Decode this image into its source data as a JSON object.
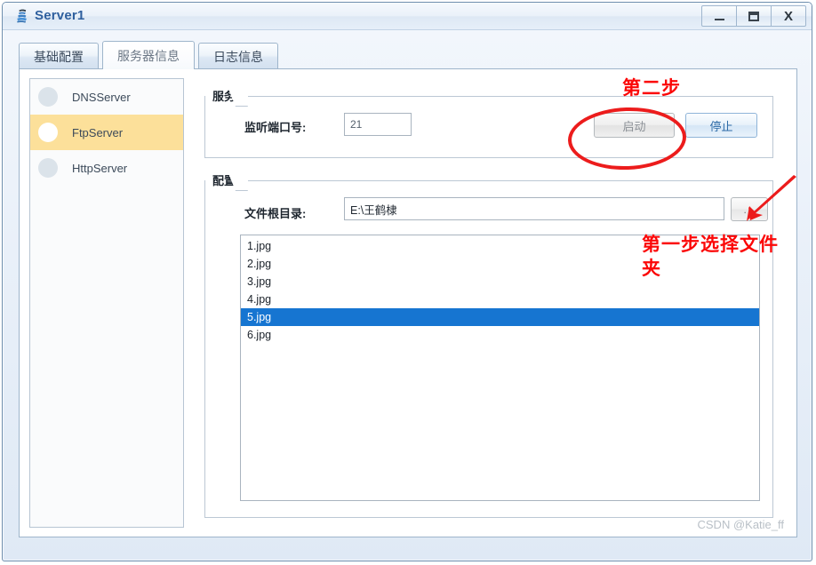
{
  "window": {
    "title": "Server1",
    "icon": "java-duke-icon",
    "controls": {
      "minimize": "_",
      "maximize": "□",
      "close": "X"
    }
  },
  "tabs": [
    {
      "label": "基础配置",
      "selected": false
    },
    {
      "label": "服务器信息",
      "selected": true
    },
    {
      "label": "日志信息",
      "selected": false
    }
  ],
  "sidebar": {
    "items": [
      {
        "label": "DNSServer",
        "selected": false
      },
      {
        "label": "FtpServer",
        "selected": true
      },
      {
        "label": "HttpServer",
        "selected": false
      }
    ]
  },
  "service_group": {
    "title": "服务",
    "port_label": "监听端口号:",
    "port_value": "21",
    "start_button": "启动",
    "stop_button": "停止"
  },
  "config_group": {
    "title": "配置",
    "root_label": "文件根目录:",
    "root_value": "E:\\王鹤棣",
    "browse_button": "...",
    "files": [
      {
        "name": "1.jpg",
        "selected": false
      },
      {
        "name": "2.jpg",
        "selected": false
      },
      {
        "name": "3.jpg",
        "selected": false
      },
      {
        "name": "4.jpg",
        "selected": false
      },
      {
        "name": "5.jpg",
        "selected": true
      },
      {
        "name": "6.jpg",
        "selected": false
      }
    ]
  },
  "annotations": {
    "step_two": "第二步",
    "step_one": "第一步选择文件夹",
    "color": "#fb0707"
  },
  "watermark": "CSDN @Katie_ff"
}
